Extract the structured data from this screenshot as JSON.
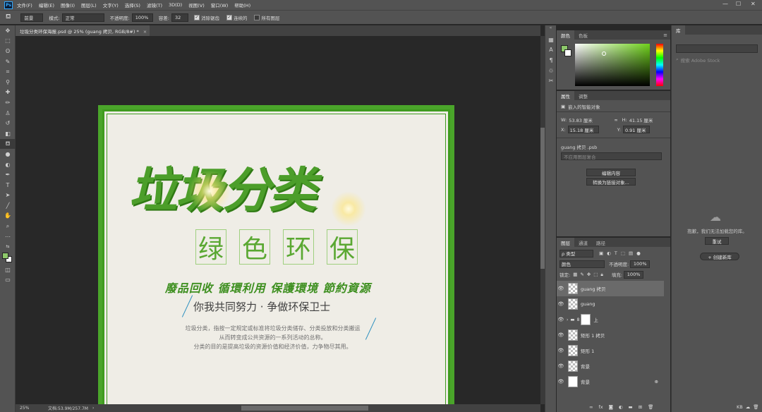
{
  "app": {
    "logo_text": "Ps"
  },
  "menubar": {
    "items": [
      "文件(F)",
      "编辑(E)",
      "图像(I)",
      "图层(L)",
      "文字(Y)",
      "选择(S)",
      "滤镜(T)",
      "3D(D)",
      "视图(V)",
      "窗口(W)",
      "帮助(H)"
    ]
  },
  "window_controls": {
    "minimize": "—",
    "maximize": "☐",
    "close": "✕"
  },
  "options_bar": {
    "preset": "前景",
    "mode_label": "模式:",
    "mode_value": "正常",
    "opacity_label": "不透明度:",
    "opacity_value": "100%",
    "tolerance_label": "容差:",
    "tolerance_value": "32",
    "antialias_label": "消除锯齿",
    "contiguous_label": "连续的",
    "all_layers_label": "所有图层"
  },
  "document": {
    "tab_title": "垃圾分类环保海报.psd @ 25% (guang 拷贝, RGB/8#) *",
    "tab_close": "×",
    "zoom": "25%",
    "doc_info": "文档:53.9M/257.7M"
  },
  "poster": {
    "title": "垃圾分类",
    "subtitle_chars": [
      "绿",
      "色",
      "环",
      "保"
    ],
    "slogan": "廢品回收  循環利用  保護環境  節約資源",
    "motto": "你我共同努力 · 争做环保卫士",
    "desc_lines": [
      "垃圾分类，指按一定规定或标准将垃圾分类储存、分类投放和分类搬运",
      "从而转变成公共资源的一系列活动的总称。",
      "分类的目的是提高垃圾的资源价值和经济价值，力争物尽其用。"
    ]
  },
  "color_panel": {
    "tabs": [
      "颜色",
      "色板"
    ],
    "foreground": "#8dc86a",
    "background": "#ffffff",
    "hue": "#6fd11b"
  },
  "properties_panel": {
    "tabs": [
      "属性",
      "调整"
    ],
    "type_label": "嵌入的智能对象",
    "w_label": "W:",
    "w_value": "53.83 厘米",
    "h_label": "H:",
    "h_value": "41.15 厘米",
    "x_label": "X:",
    "x_value": "15.18 厘米",
    "y_label": "Y:",
    "y_value": "0.91 厘米",
    "file_name": "guang 拷贝 .psb",
    "comp_placeholder": "不应用图层复合",
    "edit_button": "编辑内容",
    "convert_button": "转换为链接对象..."
  },
  "layers_panel": {
    "tabs": [
      "图层",
      "通道",
      "路径"
    ],
    "filter_kind": "ρ 类型",
    "blend_mode": "颜色",
    "opacity_label": "不透明度:",
    "opacity_value": "100%",
    "lock_label": "锁定:",
    "fill_label": "填充:",
    "fill_value": "100%",
    "layers": [
      {
        "name": "guang 拷贝",
        "selected": true,
        "thumb": "check"
      },
      {
        "name": "guang",
        "selected": false,
        "thumb": "check"
      },
      {
        "name": "上",
        "selected": false,
        "thumb": "group"
      },
      {
        "name": "矩形 1 拷贝",
        "selected": false,
        "thumb": "check"
      },
      {
        "name": "矩形 1",
        "selected": false,
        "thumb": "check"
      },
      {
        "name": "背景",
        "selected": false,
        "thumb": "check"
      },
      {
        "name": "背景",
        "selected": false,
        "thumb": "white"
      }
    ],
    "footer_icons": [
      "link-icon",
      "fx-icon",
      "mask-icon",
      "adjustment-icon",
      "folder-icon",
      "new-layer-icon",
      "trash-icon"
    ],
    "footer_fx": "fx"
  },
  "library_panel": {
    "tab": "库",
    "search_placeholder": "搜索 Adobe Stock",
    "message": "抱歉，我们无法加载您的库。",
    "retry_button": "重试",
    "create_button": "+ 创建新库",
    "footer_kb": "KB"
  }
}
